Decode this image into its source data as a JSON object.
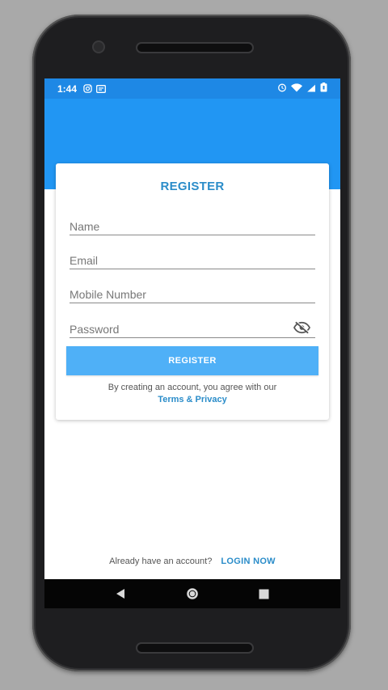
{
  "status_bar": {
    "time": "1:44",
    "left_icons": [
      "instagram-icon",
      "message-icon"
    ],
    "right_icons": [
      "alarm-icon",
      "wifi-icon",
      "signal-icon",
      "battery-icon"
    ]
  },
  "register_card": {
    "title": "REGISTER",
    "fields": {
      "name": {
        "placeholder": "Name",
        "value": ""
      },
      "email": {
        "placeholder": "Email",
        "value": ""
      },
      "mobile": {
        "placeholder": "Mobile Number",
        "value": ""
      },
      "password": {
        "placeholder": "Password",
        "value": ""
      }
    },
    "register_button": "REGISTER",
    "agreement_text": "By creating an account, you agree with our",
    "terms_link": "Terms & Privacy"
  },
  "login_prompt": {
    "text": "Already have an account?",
    "link": "LOGIN NOW"
  },
  "colors": {
    "status_bar": "#1e88e5",
    "header": "#2196f3",
    "accent": "#2a8cc9",
    "button": "#4fb0f7"
  },
  "nav_bar": {
    "buttons": [
      "back-icon",
      "home-icon",
      "recents-icon"
    ]
  }
}
